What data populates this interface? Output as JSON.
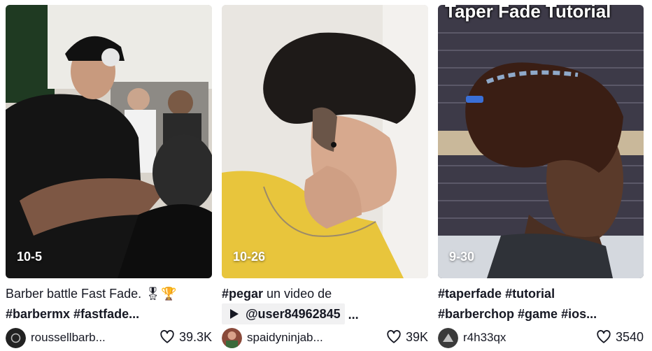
{
  "cards": [
    {
      "date": "10-5",
      "caption_text": "Barber battle Fast Fade.",
      "caption_emojis": "🎖🏆",
      "hashtags_line2": "#barbermx #fastfade...",
      "username": "roussellbarb...",
      "likes": "39.3K"
    },
    {
      "date": "10-26",
      "caption_tag": "#pegar",
      "caption_text": " un video de",
      "mention": "@user84962845",
      "mention_suffix": " ...",
      "username": "spaidyninjab...",
      "likes": "39K"
    },
    {
      "date": "9-30",
      "overlay_title": "Taper Fade Tutorial",
      "caption_tag_1": "#taperfade",
      "caption_tag_2": "#tutorial",
      "hashtags_line2": "#barberchop #game #ios...",
      "username": "r4h33qx",
      "likes": "3540"
    }
  ],
  "icons": {
    "like": "heart-outline-icon",
    "play": "play-icon"
  },
  "colors": {
    "text": "#161823",
    "chip_bg": "#f1f1f2"
  }
}
